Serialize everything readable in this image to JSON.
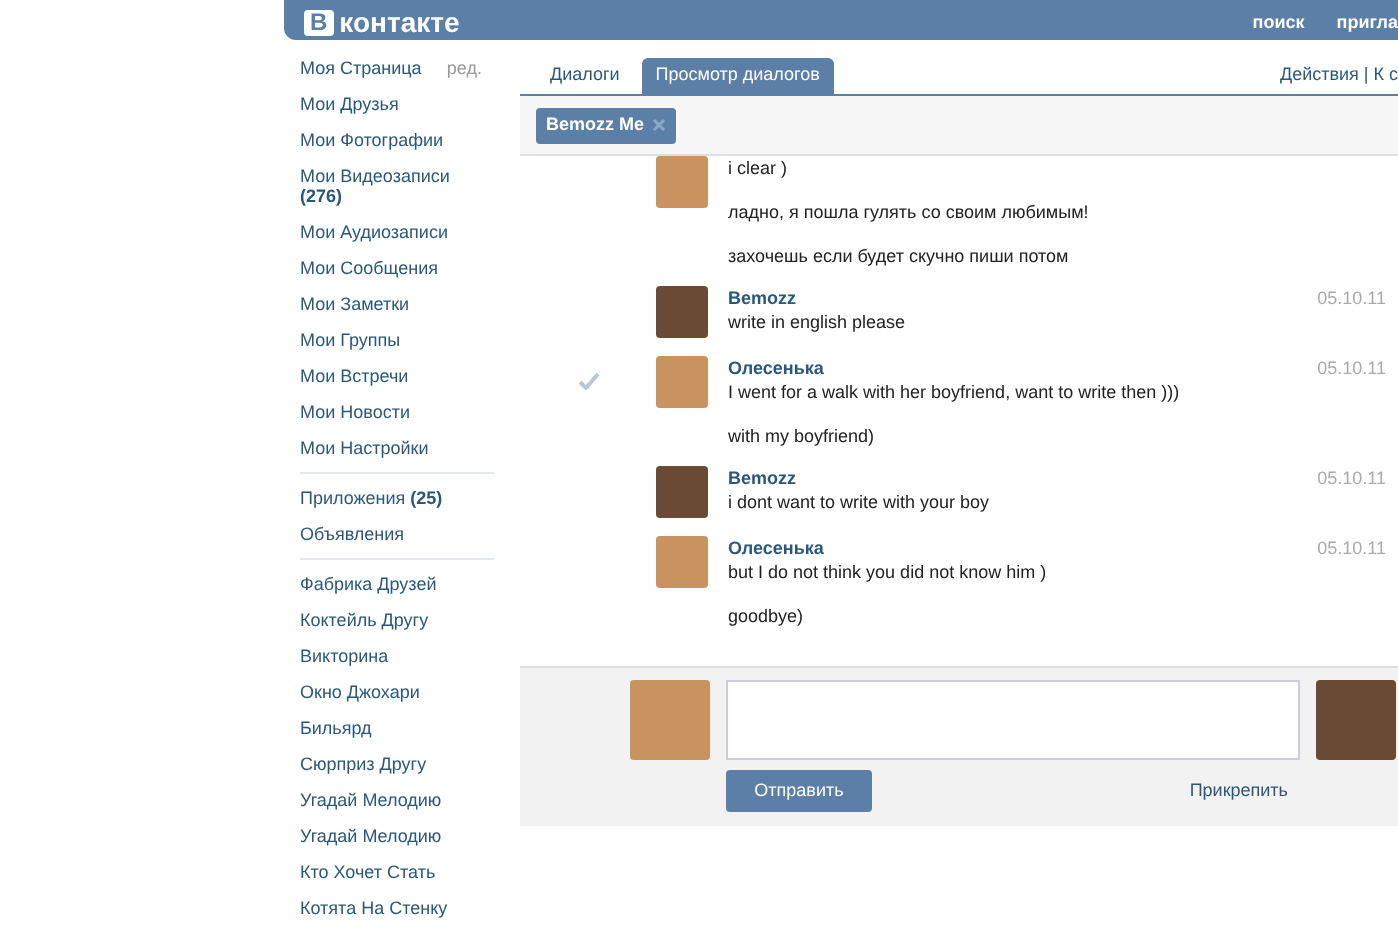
{
  "header": {
    "logo_letter": "В",
    "logo_text": "контакте",
    "nav": [
      "поиск",
      "пригла"
    ]
  },
  "sidebar": {
    "edit_link": "ред.",
    "groups": [
      [
        "Моя Страница",
        "Мои Друзья",
        "Мои Фотографии",
        "Мои Видеозаписи **(276)**",
        "Мои Аудиозаписи",
        "Мои Сообщения",
        "Мои Заметки",
        "Мои Группы",
        "Мои Встречи",
        "Мои Новости",
        "Мои Настройки"
      ],
      [
        "Приложения **(25)**",
        "Объявления"
      ],
      [
        "Фабрика Друзей",
        "Коктейль Другу",
        "Викторина",
        "Окно Джохари",
        "Бильярд",
        "Сюрприз Другу",
        "Угадай Мелодию",
        "Угадай Мелодию",
        "Кто Хочет Стать",
        "Котята На Стенку"
      ]
    ]
  },
  "tabs": [
    {
      "label": "Диалоги",
      "selected": false
    },
    {
      "label": "Просмотр диалогов",
      "selected": true
    }
  ],
  "actions": "Действия | К с",
  "chip": {
    "label": "Bemozz Me"
  },
  "messages": [
    {
      "color": "#c8935e",
      "selected": false,
      "lines": [
        "i clear )",
        "ладно, я пошла гулять со своим любимым!",
        "захочешь если будет скучно пиши потом"
      ]
    },
    {
      "author": "Bemozz",
      "date": "05.10.11",
      "color": "#6b4a35",
      "selected": false,
      "lines": [
        "write in english please"
      ]
    },
    {
      "author": "Олесенька",
      "date": "05.10.11",
      "color": "#c8935e",
      "selected": true,
      "lines": [
        "I went for a walk with her boyfriend, want to write then )))",
        "with my boyfriend)"
      ]
    },
    {
      "author": "Bemozz",
      "date": "05.10.11",
      "color": "#6b4a35",
      "selected": false,
      "lines": [
        "i dont want to write with your boy"
      ]
    },
    {
      "author": "Олесенька",
      "date": "05.10.11",
      "color": "#c8935e",
      "selected": false,
      "lines": [
        "but I do not think you did not know him )",
        "goodbye)"
      ]
    }
  ],
  "composer": {
    "send": "Отправить",
    "attach": "Прикрепить"
  }
}
